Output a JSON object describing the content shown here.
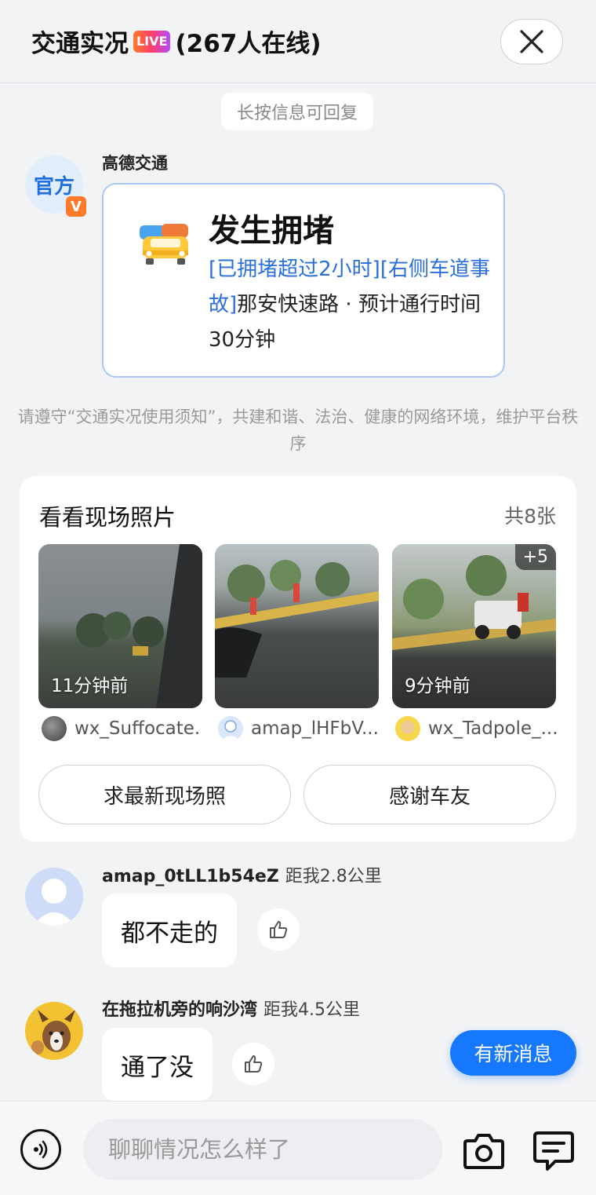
{
  "header": {
    "title_prefix": "交通实况",
    "live_badge": "LIVE",
    "title_suffix": "(267人在线)",
    "close_icon": "close-icon"
  },
  "hint": "长按信息可回复",
  "official": {
    "avatar_text": "官方",
    "badge": "V",
    "name": "高德交通",
    "card": {
      "icon": "traffic-jam-cars-icon",
      "title": "发生拥堵",
      "tag1": "[已拥堵超过2小时]",
      "tag2": "[右侧车道事故]",
      "body": "那安快速路 · 预计通行时间30分钟"
    }
  },
  "rules_notice": "请遵守“交通实况使用须知”，共建和谐、法治、健康的网络环境，维护平台秩序",
  "photos": {
    "title": "看看现场照片",
    "count": "共8张",
    "items": [
      {
        "time": "11分钟前",
        "uploader": "wx_Suffocate.",
        "more": ""
      },
      {
        "time": "",
        "uploader": "amap_lHFbV...",
        "more": ""
      },
      {
        "time": "9分钟前",
        "uploader": "wx_Tadpole_...",
        "more": "+5"
      }
    ],
    "request_button": "求最新现场照",
    "thanks_button": "感谢车友"
  },
  "messages": [
    {
      "user": "amap_0tLL1b54eZ",
      "distance": "距我2.8公里",
      "text": "都不走的"
    },
    {
      "user": "在拖拉机旁的响沙湾",
      "distance": "距我4.5公里",
      "text": "通了没"
    }
  ],
  "new_message_button": "有新消息",
  "input": {
    "placeholder": "聊聊情况怎么样了"
  },
  "colors": {
    "accent": "#1677ff",
    "highlight": "#2a6fdb",
    "badge_orange": "#ff7a2a"
  }
}
